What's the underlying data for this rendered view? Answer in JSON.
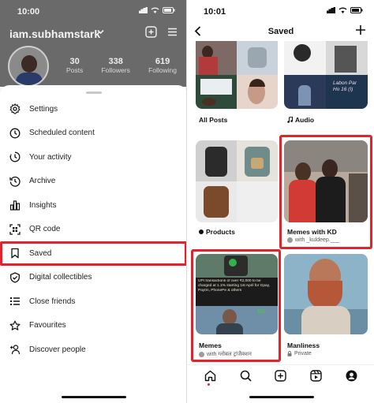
{
  "left": {
    "status_time": "10:00",
    "profile": {
      "handle": "iam.subhamstark",
      "posts_count": "30",
      "posts_label": "Posts",
      "followers_count": "338",
      "followers_label": "Followers",
      "following_count": "619",
      "following_label": "Following"
    },
    "menu": [
      {
        "label": "Settings",
        "icon": "gear-icon"
      },
      {
        "label": "Scheduled content",
        "icon": "clock-icon"
      },
      {
        "label": "Your activity",
        "icon": "activity-icon"
      },
      {
        "label": "Archive",
        "icon": "archive-icon"
      },
      {
        "label": "Insights",
        "icon": "bar-chart-icon"
      },
      {
        "label": "QR code",
        "icon": "qr-code-icon"
      },
      {
        "label": "Saved",
        "icon": "bookmark-icon",
        "highlighted": true
      },
      {
        "label": "Digital collectibles",
        "icon": "shield-check-icon"
      },
      {
        "label": "Close friends",
        "icon": "list-icon"
      },
      {
        "label": "Favourites",
        "icon": "star-icon"
      },
      {
        "label": "Discover people",
        "icon": "add-person-icon"
      }
    ]
  },
  "right": {
    "status_time": "10:01",
    "title": "Saved",
    "collections": [
      {
        "name": "All Posts",
        "sub": ""
      },
      {
        "name": "Audio",
        "sub": ""
      },
      {
        "name": "Products",
        "sub": ""
      },
      {
        "name": "Memes with KD",
        "sub": "with _kuldeep.___"
      },
      {
        "name": "Memes",
        "sub": "with ग्लोबल ट्रांजैक्शन"
      },
      {
        "name": "Manliness",
        "sub": "Private"
      }
    ],
    "meme_caption": "UPI transactions of over ₹2,000 to be charged at 1.1% starting 1st April for Gpay, Paytm, PhonePe & others",
    "audio_overlay": "Labon Par\nHo 16 (I)"
  },
  "colors": {
    "highlight_red": "#e0242c"
  }
}
